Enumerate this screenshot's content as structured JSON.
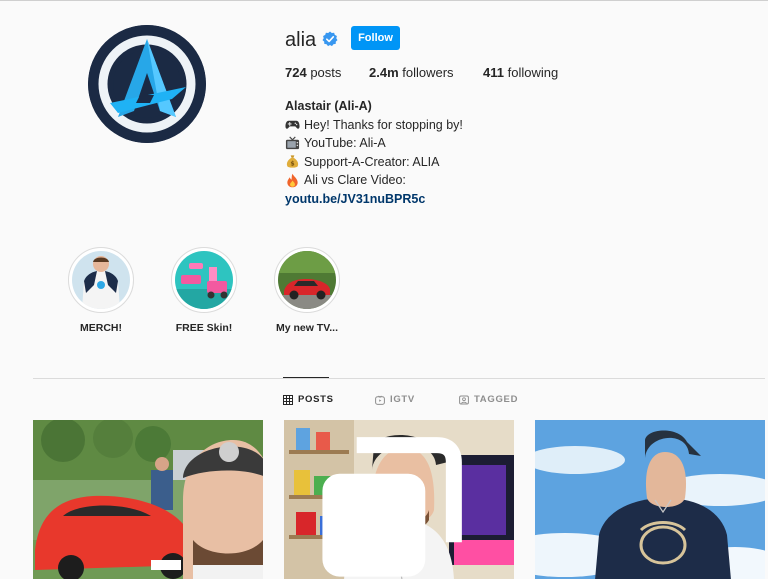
{
  "profile": {
    "username": "alia",
    "follow_label": "Follow",
    "stats": {
      "posts_count": "724",
      "posts_label": "posts",
      "followers_count": "2.4m",
      "followers_label": "followers",
      "following_count": "411",
      "following_label": "following"
    },
    "bio": {
      "full_name": "Alastair (Ali-A)",
      "lines": [
        {
          "icon": "game-controller-icon",
          "text": "Hey! Thanks for stopping by!"
        },
        {
          "icon": "tv-icon",
          "text": "YouTube: Ali-A"
        },
        {
          "icon": "money-bag-icon",
          "text": "Support-A-Creator: ALIA"
        },
        {
          "icon": "fire-icon",
          "text": "Ali vs Clare Video:"
        }
      ],
      "link": "youtu.be/JV31nuBPR5c"
    }
  },
  "highlights": [
    {
      "label": "MERCH!"
    },
    {
      "label": "FREE Skin!"
    },
    {
      "label": "My new TV..."
    }
  ],
  "tabs": [
    {
      "label": "POSTS",
      "icon": "grid-icon",
      "active": true
    },
    {
      "label": "IGTV",
      "icon": "igtv-icon",
      "active": false
    },
    {
      "label": "TAGGED",
      "icon": "tagged-icon",
      "active": false
    }
  ],
  "colors": {
    "follow_button": "#0095f6",
    "link": "#00376b",
    "verified_badge": "#3897f0",
    "background": "#fafafa"
  }
}
